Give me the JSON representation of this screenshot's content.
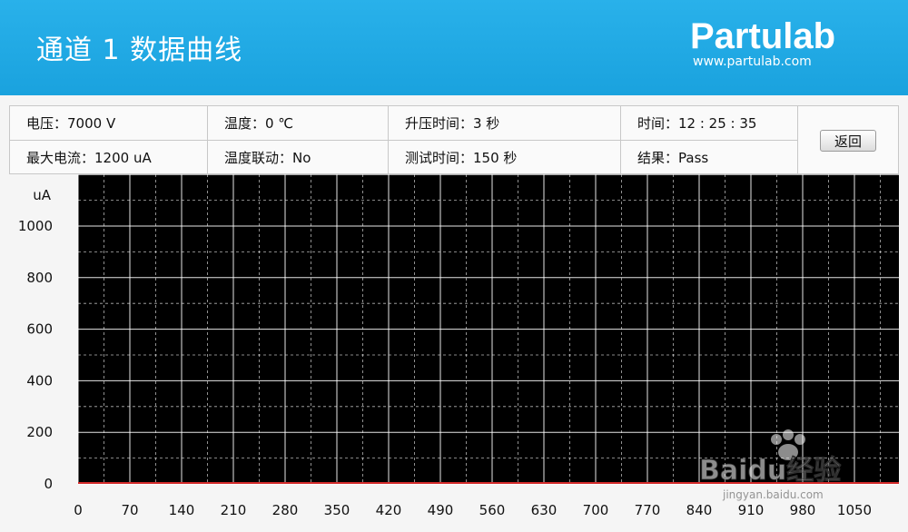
{
  "header": {
    "title": "通道 1 数据曲线",
    "brand": "Partulab",
    "brand_url": "www.partulab.com"
  },
  "info": {
    "voltage": "电压：7000  V",
    "temperature": "温度：0 ℃",
    "ramp_time": "升压时间：3 秒",
    "clock": "时间：12 : 25 : 35",
    "max_current": "最大电流：1200 uA",
    "temp_linkage": "温度联动：No",
    "test_time": "测试时间：150 秒",
    "result": "结果：Pass"
  },
  "back_label": "返回",
  "watermark": "Baidu经验",
  "watermark_url": "jingyan.baidu.com",
  "colors": {
    "header_bg": "#1ea8e2",
    "plot_bg": "#000000",
    "grid": "#ffffff",
    "series": "#d42b2b"
  },
  "chart_data": {
    "type": "line",
    "ylabel": "uA",
    "ylim": [
      0,
      1200
    ],
    "yticks": [
      0,
      200,
      400,
      600,
      800,
      1000
    ],
    "xlim": [
      0,
      1120
    ],
    "xticks": [
      0,
      70,
      140,
      210,
      280,
      350,
      420,
      490,
      560,
      630,
      700,
      770,
      840,
      910,
      980,
      1050
    ],
    "grid": true,
    "series": [
      {
        "x": [
          0,
          1120
        ],
        "values": [
          0,
          0
        ]
      }
    ]
  }
}
